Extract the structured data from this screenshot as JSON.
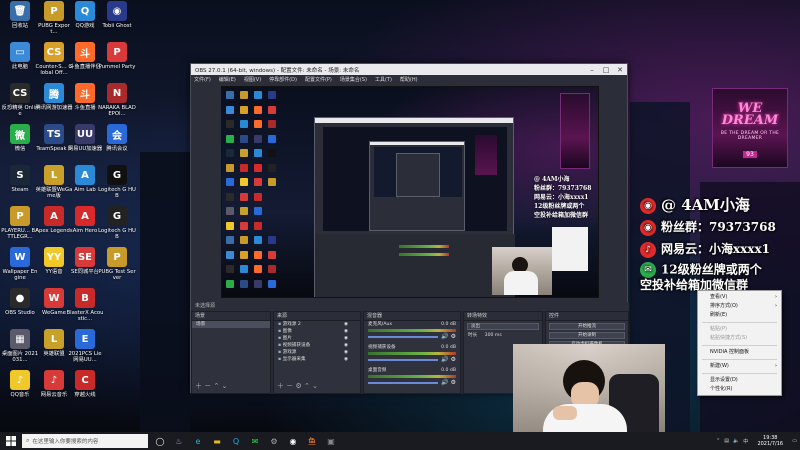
{
  "desktop": {
    "icons": [
      {
        "label": "回收站",
        "glyph": "🗑",
        "color": "#3a6ea8"
      },
      {
        "label": "PUBG Export...",
        "glyph": "P",
        "color": "#c89a2a"
      },
      {
        "label": "QQ游戏",
        "glyph": "Q",
        "color": "#2a8ad8"
      },
      {
        "label": "Tobii Ghost",
        "glyph": "◉",
        "color": "#2a3a8a"
      },
      {
        "label": "此电脑",
        "glyph": "▭",
        "color": "#3a8ad8"
      },
      {
        "label": "Counter-S... Global Off...",
        "glyph": "CS",
        "color": "#d8a02a"
      },
      {
        "label": "斗鱼直播伴侣",
        "glyph": "斗",
        "color": "#ff6a2a"
      },
      {
        "label": "Pummel Party",
        "glyph": "P",
        "color": "#d83a3a"
      },
      {
        "label": "反恐精英 Online",
        "glyph": "CS",
        "color": "#2a2a2a"
      },
      {
        "label": "腾讯网游加速器",
        "glyph": "腾",
        "color": "#2a8ad8"
      },
      {
        "label": "斗鱼直播",
        "glyph": "斗",
        "color": "#ff6a2a"
      },
      {
        "label": "NARAKA BLADEPOI...",
        "glyph": "N",
        "color": "#a82a2a"
      },
      {
        "label": "微信",
        "glyph": "微",
        "color": "#2aae4a"
      },
      {
        "label": "TeamSpeak 3",
        "glyph": "TS",
        "color": "#2a4a8a"
      },
      {
        "label": "网易UU加速器",
        "glyph": "UU",
        "color": "#3a3a6a"
      },
      {
        "label": "腾讯会议",
        "glyph": "会",
        "color": "#2a6ad8"
      },
      {
        "label": "Steam",
        "glyph": "S",
        "color": "#1b2838"
      },
      {
        "label": "英雄联盟WeGame版",
        "glyph": "L",
        "color": "#c8a02a"
      },
      {
        "label": "Aim Lab",
        "glyph": "A",
        "color": "#2a8ad8"
      },
      {
        "label": "Logitech G HUB",
        "glyph": "G",
        "color": "#111111"
      },
      {
        "label": "PLAYERU... BATTLEGR...",
        "glyph": "P",
        "color": "#c89a2a"
      },
      {
        "label": "Apex Legends",
        "glyph": "A",
        "color": "#c82a2a"
      },
      {
        "label": "Aim Hero",
        "glyph": "A",
        "color": "#d82a2a"
      },
      {
        "label": "Logitech G HUB",
        "glyph": "G",
        "color": "#222222"
      },
      {
        "label": "Wallpaper Engine",
        "glyph": "W",
        "color": "#2a6ad8"
      },
      {
        "label": "YY语音",
        "glyph": "YY",
        "color": "#f0c82a"
      },
      {
        "label": "SE同城平台",
        "glyph": "SE",
        "color": "#d83a3a"
      },
      {
        "label": "PUBG Test Server",
        "glyph": "P",
        "color": "#c89a2a"
      },
      {
        "label": "OBS Studio",
        "glyph": "●",
        "color": "#2a2a2a"
      },
      {
        "label": "WeGame",
        "glyph": "W",
        "color": "#d83a3a"
      },
      {
        "label": "BlasterX Acoustic...",
        "glyph": "B",
        "color": "#c82a2a"
      },
      {
        "label": "",
        "glyph": "",
        "color": ""
      },
      {
        "label": "桌面图片 2021031...",
        "glyph": "▦",
        "color": "#5a5a6a"
      },
      {
        "label": "英雄联盟",
        "glyph": "L",
        "color": "#c8a02a"
      },
      {
        "label": "2021PCS Lie 网易UU...",
        "glyph": "E",
        "color": "#2a6ad8"
      },
      {
        "label": "",
        "glyph": "",
        "color": ""
      },
      {
        "label": "QQ音乐",
        "glyph": "♪",
        "color": "#f0c82a"
      },
      {
        "label": "网易云音乐",
        "glyph": "♪",
        "color": "#d83a3a"
      },
      {
        "label": "穿越火线",
        "glyph": "C",
        "color": "#c82a2a"
      },
      {
        "label": "",
        "glyph": "",
        "color": ""
      }
    ]
  },
  "billboard": {
    "big": "WE DREAM",
    "small": "BE THE DREAM OR THE DREAMER",
    "tag": "93"
  },
  "overlay": {
    "handle": "@ 4AM小海",
    "fans": "粉丝群：79373768",
    "netease": "网易云：小海xxxx1",
    "note_line1": "12级粉丝牌或两个",
    "note_line2": "空投补给箱加微信群"
  },
  "obs": {
    "title": "OBS 27.0.1 (64-bit, windows) - 配置文件: 未命名 - 场景: 未命名",
    "menu": [
      "文件(F)",
      "编辑(E)",
      "视图(V)",
      "停靠部件(D)",
      "配置文件(P)",
      "场景集合(S)",
      "工具(T)",
      "帮助(H)"
    ],
    "docks": {
      "scenes": {
        "title": "场景",
        "items": [
          "场景"
        ]
      },
      "sources": {
        "title": "来源",
        "items": [
          "游戏源 2",
          "图像",
          "图片",
          "视频捕获设备",
          "游戏源",
          "显示器采集"
        ]
      },
      "mixer": {
        "title": "混音器",
        "channels": [
          {
            "name": "麦克风/Aux",
            "level": "0.0 dB"
          },
          {
            "name": "视频捕获设备",
            "level": "0.0 dB"
          },
          {
            "name": "桌面音频",
            "level": "0.0 dB"
          }
        ]
      },
      "transitions": {
        "title": "转场特效",
        "type": "淡出",
        "duration_label": "时长",
        "duration": "300 ms"
      },
      "controls": {
        "title": "控件",
        "buttons": [
          "开始推流",
          "开始录制",
          "启动虚拟摄像机",
          "工作室模式",
          "设置",
          "退出"
        ]
      }
    },
    "status": "未选择源"
  },
  "context_menu": {
    "items": [
      {
        "label": "查看(V)",
        "arrow": true,
        "disabled": false
      },
      {
        "label": "排序方式(O)",
        "arrow": true,
        "disabled": false
      },
      {
        "label": "刷新(E)",
        "arrow": false,
        "disabled": false
      },
      {
        "sep": true
      },
      {
        "label": "粘贴(P)",
        "arrow": false,
        "disabled": true
      },
      {
        "label": "粘贴快捷方式(S)",
        "arrow": false,
        "disabled": true
      },
      {
        "sep": true
      },
      {
        "label": "NVIDIA 控制面板",
        "arrow": false,
        "disabled": false
      },
      {
        "sep": true
      },
      {
        "label": "新建(W)",
        "arrow": true,
        "disabled": false
      },
      {
        "sep": true
      },
      {
        "label": "显示设置(D)",
        "arrow": false,
        "disabled": false
      },
      {
        "label": "个性化(R)",
        "arrow": false,
        "disabled": false
      }
    ]
  },
  "taskbar": {
    "search_placeholder": "在这里输入你要搜索的内容",
    "time": "19:38",
    "date": "2021/7/16"
  },
  "colors": {
    "obs_bg": "#2b2e38",
    "taskbar": "#1a1b20",
    "overlay_red": "#e02a2a",
    "overlay_green": "#2aae4a"
  }
}
